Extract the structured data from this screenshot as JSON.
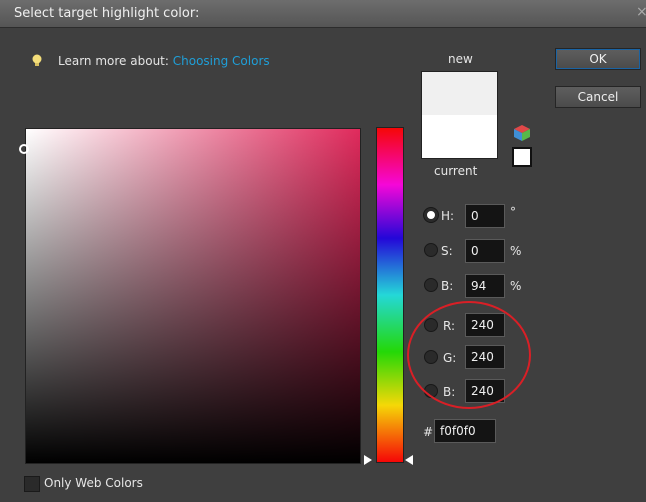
{
  "window": {
    "title": "Select target highlight color:",
    "close_glyph": "×"
  },
  "learn": {
    "prefix": "Learn more about:",
    "link": "Choosing Colors"
  },
  "preview": {
    "new_label": "new",
    "current_label": "current",
    "new_color": "#f0f0f0",
    "current_color": "#ffffff"
  },
  "buttons": {
    "ok": "OK",
    "cancel": "Cancel"
  },
  "fields": {
    "h": {
      "label": "H:",
      "value": "0",
      "unit": "°",
      "selected": true
    },
    "s": {
      "label": "S:",
      "value": "0",
      "unit": "%"
    },
    "b": {
      "label": "B:",
      "value": "94",
      "unit": "%"
    },
    "r": {
      "label": "R:",
      "value": "240"
    },
    "g": {
      "label": "G:",
      "value": "240"
    },
    "b2": {
      "label": "B:",
      "value": "240"
    },
    "hex": {
      "label": "#",
      "value": "f0f0f0"
    }
  },
  "only_web_colors": {
    "label": "Only Web Colors",
    "checked": false
  },
  "colors": {
    "annotation_circle": "#d91f26",
    "link": "#1f9fd8",
    "field_hue": "#e02a5c"
  }
}
